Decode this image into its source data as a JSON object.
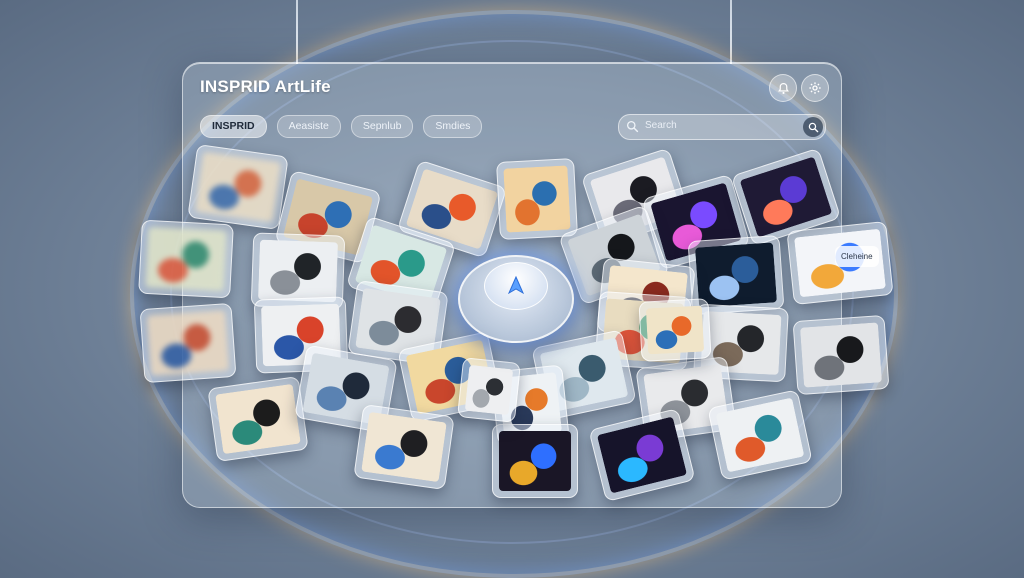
{
  "app": {
    "title": "INSPRID ArtLife"
  },
  "tabs": [
    {
      "label": "INSPRID",
      "active": true
    },
    {
      "label": "Aeasiste",
      "active": false
    },
    {
      "label": "Sepnlub",
      "active": false
    },
    {
      "label": "Smdies",
      "active": false
    }
  ],
  "search": {
    "placeholder": "Search"
  },
  "header_icons": [
    "bell-icon",
    "settings-icon"
  ],
  "hub": {
    "icon": "navigation-arrow-icon",
    "accent": "#5aa0ff"
  },
  "featured_chip": {
    "label": "Cleheine"
  },
  "colors": {
    "panel_glow": "#6ea0ff",
    "halo_warm": "#ffc878"
  },
  "gallery": [
    {
      "name": "artwork-portrait-hat",
      "colors": [
        "#f2d3a0",
        "#2b6fb0",
        "#e2732f"
      ]
    },
    {
      "name": "artwork-abstract-figure",
      "colors": [
        "#e8dcc8",
        "#e85a2a",
        "#2a4f8a"
      ]
    },
    {
      "name": "artwork-portrait-blue",
      "colors": [
        "#d8c8a8",
        "#2e6fb5",
        "#c7432c"
      ]
    },
    {
      "name": "artwork-dark-geometric",
      "colors": [
        "#e9e9ec",
        "#1b1b22",
        "#6b6b78"
      ]
    },
    {
      "name": "artwork-neon-wave",
      "colors": [
        "#1a1530",
        "#7a4bff",
        "#e85ad8"
      ]
    },
    {
      "name": "artwork-purple-shape",
      "colors": [
        "#1f1a35",
        "#5b3bd4",
        "#ff7a5a"
      ]
    },
    {
      "name": "artwork-teal-figure",
      "colors": [
        "#d8e8e4",
        "#2a9a8a",
        "#e2542a"
      ]
    },
    {
      "name": "artwork-monochrome-fold",
      "colors": [
        "#eceff2",
        "#202428",
        "#8a9098"
      ]
    },
    {
      "name": "artwork-orange-figure",
      "colors": [
        "#f0e4c8",
        "#e8692a",
        "#2c6fb8"
      ]
    },
    {
      "name": "artwork-portrait-man",
      "colors": [
        "#dfe3e6",
        "#2c2c30",
        "#7d8c9a"
      ]
    },
    {
      "name": "artwork-dark-silhouette",
      "colors": [
        "#cdd3d8",
        "#15171b",
        "#5d6a75"
      ]
    },
    {
      "name": "artwork-night-scene",
      "colors": [
        "#0f1c2e",
        "#2b5d9a",
        "#9cc2f2"
      ]
    },
    {
      "name": "artwork-colorful-ui",
      "colors": [
        "#f3f5f9",
        "#3b7bff",
        "#f2a83a"
      ]
    },
    {
      "name": "artwork-red-blue-shape",
      "colors": [
        "#eef0f2",
        "#d9432a",
        "#2b57a8"
      ]
    },
    {
      "name": "artwork-seated-figure",
      "colors": [
        "#e6e8ea",
        "#24262a",
        "#7b6a5a"
      ]
    },
    {
      "name": "artwork-dark-red-face",
      "colors": [
        "#f4e6cc",
        "#8a2a1e",
        "#2a2a36"
      ]
    },
    {
      "name": "artwork-tropical",
      "colors": [
        "#e8dcc0",
        "#2f8a5a",
        "#e0553a"
      ]
    },
    {
      "name": "artwork-grey-abstract",
      "colors": [
        "#eeeff1",
        "#2c2f34",
        "#a3a8ae"
      ]
    },
    {
      "name": "artwork-dark-mask",
      "colors": [
        "#e2e4e7",
        "#18191c",
        "#6f737a"
      ]
    },
    {
      "name": "artwork-gold-portrait",
      "colors": [
        "#f1d9a0",
        "#2b5d9a",
        "#c9462c"
      ]
    },
    {
      "name": "artwork-lake-scene",
      "colors": [
        "#dfe8ee",
        "#3a5b6e",
        "#9fb7c6"
      ]
    },
    {
      "name": "artwork-portrait-street",
      "colors": [
        "#d5dde4",
        "#1f2a3a",
        "#5a82b2"
      ]
    },
    {
      "name": "artwork-woman-sketch",
      "colors": [
        "#f1e4cf",
        "#1c1c1c",
        "#2b8a7a"
      ]
    },
    {
      "name": "artwork-abstract-sculpture",
      "colors": [
        "#f0e6d4",
        "#1f1f22",
        "#3a7ad0"
      ]
    },
    {
      "name": "artwork-orange-blob",
      "colors": [
        "#eef2f5",
        "#e67a2a",
        "#2a3a5a"
      ]
    },
    {
      "name": "artwork-neon-figure",
      "colors": [
        "#1a1626",
        "#2e6fff",
        "#e8a82a"
      ]
    },
    {
      "name": "artwork-purple-swirl",
      "colors": [
        "#16142a",
        "#7a3bd4",
        "#2bb8ff"
      ]
    },
    {
      "name": "artwork-staircase",
      "colors": [
        "#e9eaec",
        "#2a2c30",
        "#8e939a"
      ]
    },
    {
      "name": "artwork-teal-orange-fold",
      "colors": [
        "#eef1f3",
        "#2a8a9a",
        "#e05a2a"
      ]
    },
    {
      "name": "artwork-blurred-left-1",
      "colors": [
        "#e9dcc4",
        "#d9653a",
        "#3a6aa8"
      ]
    },
    {
      "name": "artwork-blurred-left-2",
      "colors": [
        "#dfe4c8",
        "#2e8a6a",
        "#e05a3a"
      ]
    },
    {
      "name": "artwork-blurred-left-3",
      "colors": [
        "#ead8c0",
        "#c94a2a",
        "#2c5aa0"
      ]
    }
  ]
}
